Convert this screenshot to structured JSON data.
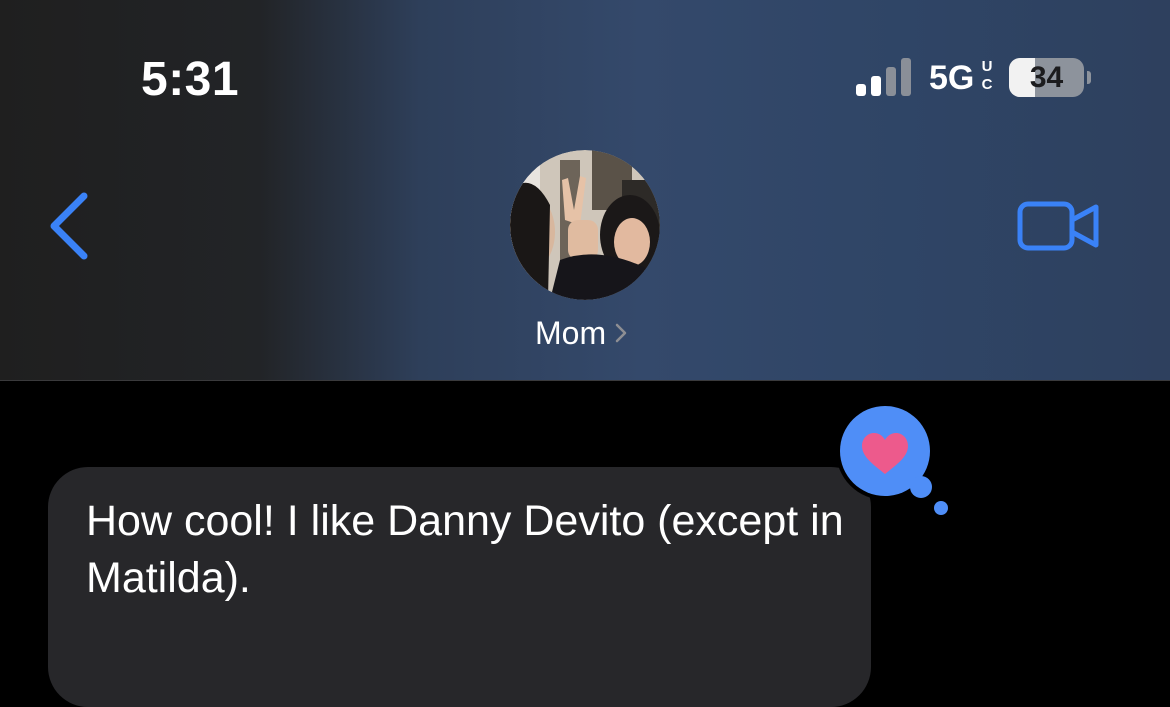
{
  "status_bar": {
    "time": "5:31",
    "network": "5G",
    "network_suffix": "UC",
    "battery_percent": 34,
    "battery_label": "34",
    "signal_bars_active": 2,
    "signal_bars_total": 4
  },
  "nav": {
    "back_icon": "chevron-left-icon",
    "video_icon": "video-camera-icon",
    "contact_name": "Mom",
    "contact_chevron_icon": "chevron-right-icon",
    "accent_color": "#3a82f7"
  },
  "conversation": {
    "messages": [
      {
        "direction": "incoming",
        "text": "How cool!  I like Danny Devito (except in Matilda).",
        "tapback": "heart",
        "tapback_icon": "heart-icon",
        "tapback_color": "#ed5a8c"
      }
    ]
  }
}
